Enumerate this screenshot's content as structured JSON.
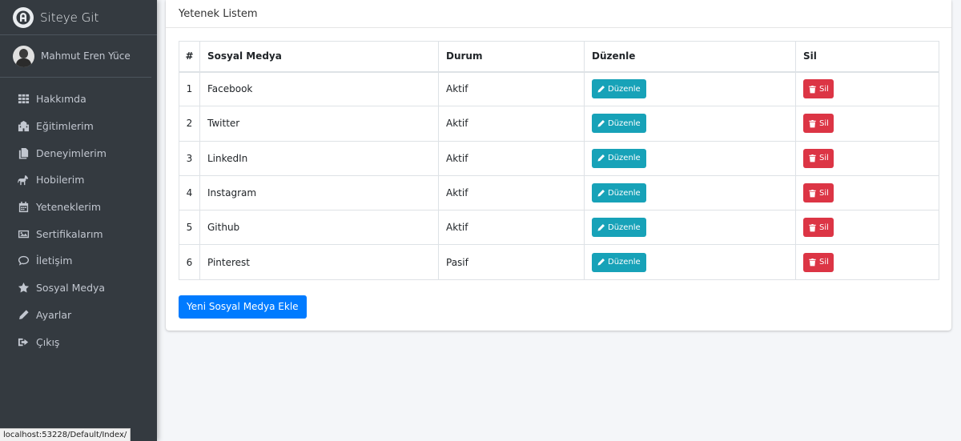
{
  "brand": {
    "title": "Siteye Git"
  },
  "user": {
    "name": "Mahmut Eren Yüce"
  },
  "nav": [
    {
      "label": "Hakkımda",
      "icon": "grid-icon"
    },
    {
      "label": "Eğitimlerim",
      "icon": "school-icon"
    },
    {
      "label": "Deneyimlerim",
      "icon": "copy-icon"
    },
    {
      "label": "Hobilerim",
      "icon": "horse-icon"
    },
    {
      "label": "Yeteneklerim",
      "icon": "calendar-icon"
    },
    {
      "label": "Sertifikalarım",
      "icon": "image-icon"
    },
    {
      "label": "İletişim",
      "icon": "comment-icon"
    },
    {
      "label": "Sosyal Medya",
      "icon": "star-icon"
    },
    {
      "label": "Ayarlar",
      "icon": "pencil-icon"
    },
    {
      "label": "Çıkış",
      "icon": "sign-out-icon"
    }
  ],
  "card": {
    "title": "Yetenek Listem"
  },
  "table": {
    "headers": [
      "#",
      "Sosyal Medya",
      "Durum",
      "Düzenle",
      "Sil"
    ],
    "rows": [
      {
        "num": "1",
        "name": "Facebook",
        "status": "Aktif"
      },
      {
        "num": "2",
        "name": "Twitter",
        "status": "Aktif"
      },
      {
        "num": "3",
        "name": "LinkedIn",
        "status": "Aktif"
      },
      {
        "num": "4",
        "name": "Instagram",
        "status": "Aktif"
      },
      {
        "num": "5",
        "name": "Github",
        "status": "Aktif"
      },
      {
        "num": "6",
        "name": "Pinterest",
        "status": "Pasif"
      }
    ],
    "edit_label": "Düzenle",
    "delete_label": "Sil"
  },
  "add_button": "Yeni Sosyal Medya Ekle",
  "statusbar": "localhost:53228/Default/Index/",
  "colors": {
    "sidebar": "#343a40",
    "info": "#17a2b8",
    "danger": "#dc3545",
    "primary": "#007bff"
  }
}
